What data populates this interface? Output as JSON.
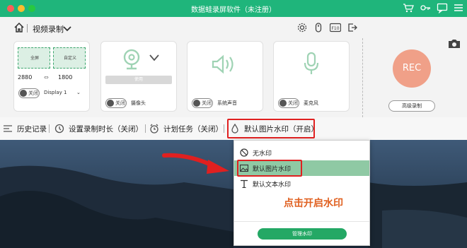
{
  "window": {
    "title": "数据蛙录屏软件（未注册）"
  },
  "nav": {
    "mode_label": "视频录制"
  },
  "screen_card": {
    "fullscreen_label": "全屏",
    "custom_label": "自定义",
    "width": "2880",
    "height": "1800",
    "toggle_label": "关闭",
    "display_label": "Display 1"
  },
  "camera_card": {
    "toggle_label": "关闭",
    "label": "摄像头",
    "btn_label": "使用"
  },
  "system_audio_card": {
    "toggle_label": "关闭",
    "label": "系统声音"
  },
  "mic_card": {
    "toggle_label": "关闭",
    "label": "麦克风"
  },
  "rec": {
    "label": "REC",
    "advanced_label": "高级录制"
  },
  "toolbar": {
    "history": "历史记录",
    "duration": "设置录制时长（关闭）",
    "schedule": "计划任务（关闭）",
    "watermark": "默认图片水印（开启）"
  },
  "dropdown": {
    "items": [
      {
        "label": "无水印",
        "icon": "no-entry-icon"
      },
      {
        "label": "默认图片水印",
        "icon": "image-icon",
        "selected": true
      },
      {
        "label": "默认文本水印",
        "icon": "text-icon"
      }
    ],
    "note": "点击开启水印",
    "manage_label": "管理水印"
  },
  "colors": {
    "accent": "#1fb57b",
    "rec": "#f0a088",
    "highlight": "#e02020"
  }
}
